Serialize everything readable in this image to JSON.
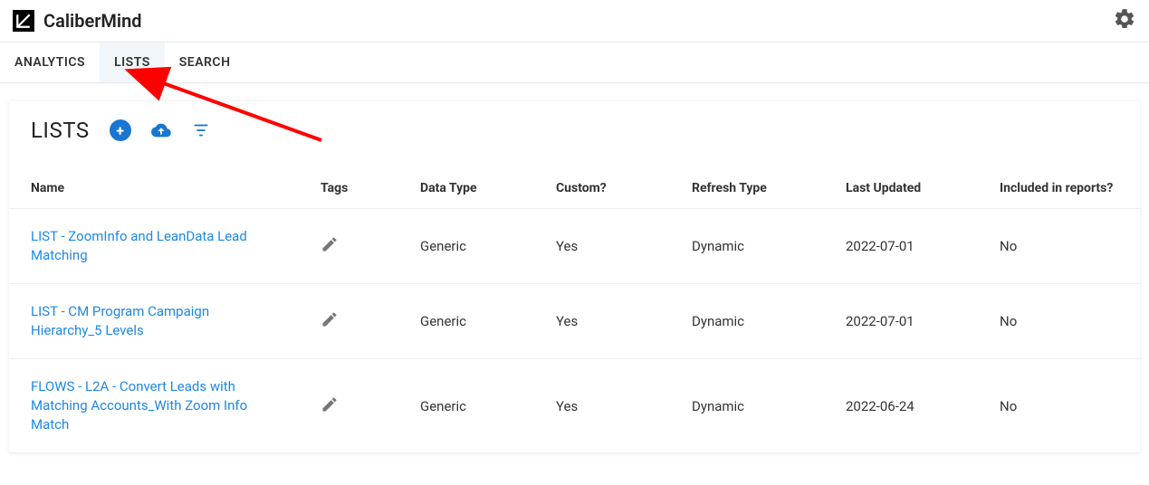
{
  "brand": {
    "name": "CaliberMind"
  },
  "tabs": [
    {
      "label": "ANALYTICS",
      "active": false
    },
    {
      "label": "LISTS",
      "active": true
    },
    {
      "label": "SEARCH",
      "active": false
    }
  ],
  "panel": {
    "title": "LISTS"
  },
  "table": {
    "headers": {
      "name": "Name",
      "tags": "Tags",
      "data_type": "Data Type",
      "custom": "Custom?",
      "refresh_type": "Refresh Type",
      "last_updated": "Last Updated",
      "included": "Included in reports?"
    },
    "rows": [
      {
        "name": "LIST - ZoomInfo and LeanData Lead Matching",
        "data_type": "Generic",
        "custom": "Yes",
        "refresh_type": "Dynamic",
        "last_updated": "2022-07-01",
        "included": "No"
      },
      {
        "name": "LIST - CM Program Campaign Hierarchy_5 Levels",
        "data_type": "Generic",
        "custom": "Yes",
        "refresh_type": "Dynamic",
        "last_updated": "2022-07-01",
        "included": "No"
      },
      {
        "name": "FLOWS - L2A - Convert Leads with Matching Accounts_With Zoom Info Match",
        "data_type": "Generic",
        "custom": "Yes",
        "refresh_type": "Dynamic",
        "last_updated": "2022-06-24",
        "included": "No"
      }
    ]
  }
}
